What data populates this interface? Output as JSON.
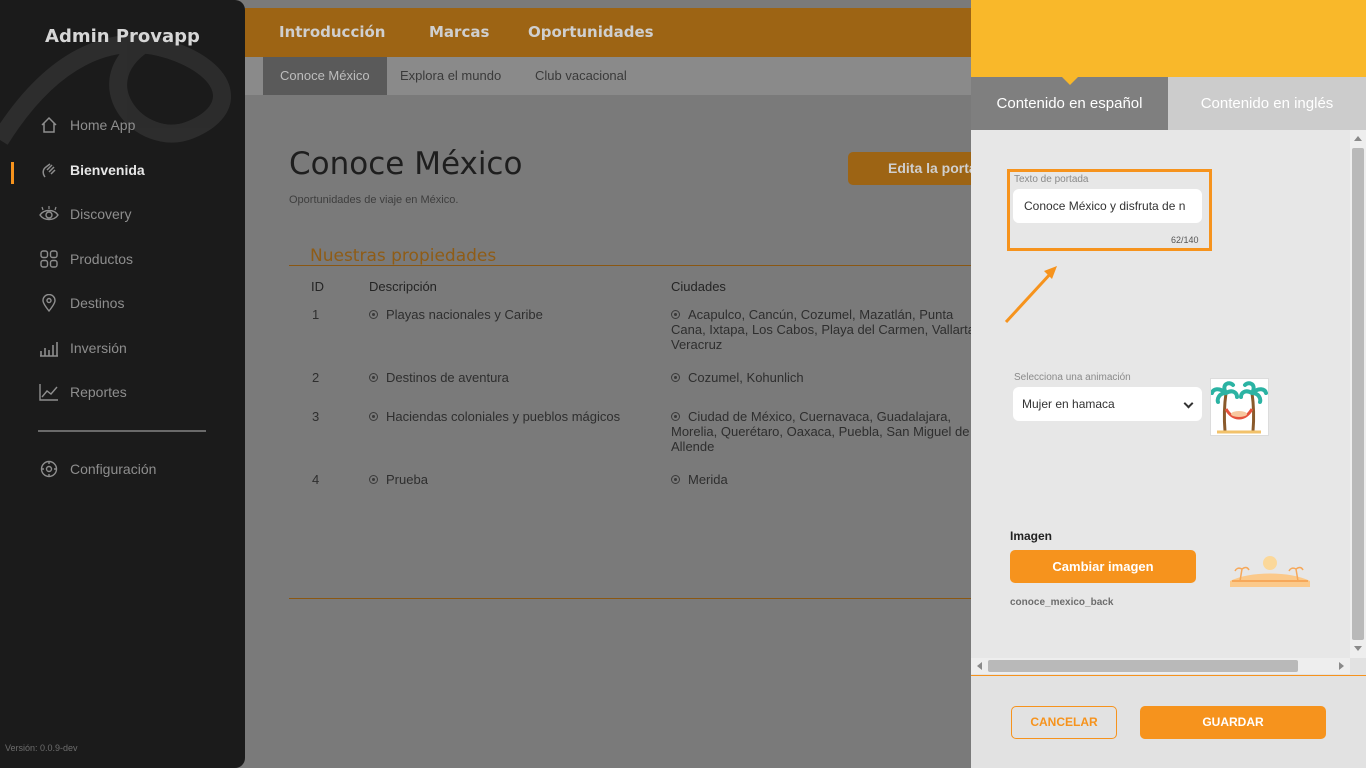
{
  "sidebar": {
    "brand": "Admin Provapp",
    "items": [
      {
        "label": "Home App",
        "icon": "home-icon"
      },
      {
        "label": "Bienvenida",
        "icon": "wave-hand-icon",
        "active": true
      },
      {
        "label": "Discovery",
        "icon": "eye-icon"
      },
      {
        "label": "Productos",
        "icon": "grid-icon"
      },
      {
        "label": "Destinos",
        "icon": "map-pin-icon"
      },
      {
        "label": "Inversión",
        "icon": "bar-chart-icon"
      },
      {
        "label": "Reportes",
        "icon": "line-chart-icon"
      }
    ],
    "settings": {
      "label": "Configuración",
      "icon": "gear-icon"
    },
    "version": "Versión: 0.0.9-dev"
  },
  "topnav": {
    "tabs": [
      "Introducción",
      "Marcas",
      "Oportunidades"
    ],
    "active": "Oportunidades"
  },
  "subnav": {
    "tabs": [
      "Conoce México",
      "Explora el mundo",
      "Club vacacional"
    ],
    "active": "Conoce México"
  },
  "main": {
    "title": "Conoce México",
    "subtitle": "Oportunidades de viaje en México.",
    "edit_button": "Edita la porta",
    "section_title": "Nuestras propiedades",
    "table": {
      "headers": [
        "ID",
        "Descripción",
        "Ciudades"
      ],
      "rows": [
        {
          "id": "1",
          "desc": "Playas nacionales y Caribe",
          "cities": [
            "Acapulco, Cancún, Cozumel, Mazatlán, Punta",
            "Cana, Ixtapa, Los Cabos, Playa del Carmen, Vallarta,",
            "Veracruz"
          ]
        },
        {
          "id": "2",
          "desc": "Destinos de aventura",
          "cities": [
            "Cozumel, Kohunlich"
          ]
        },
        {
          "id": "3",
          "desc": "Haciendas coloniales y pueblos mágicos",
          "cities": [
            "Ciudad de México, Cuernavaca, Guadalajara,",
            "Morelia, Querétaro, Oaxaca, Puebla, San Miguel de",
            "Allende"
          ]
        },
        {
          "id": "4",
          "desc": "Prueba",
          "cities": [
            "Merida"
          ]
        }
      ]
    }
  },
  "panel": {
    "tabs": {
      "spanish": "Contenido en español",
      "english": "Contenido en inglés"
    },
    "cover_text": {
      "label": "Texto de portada",
      "value": "Conoce México y disfruta de n",
      "counter": "62/140"
    },
    "animation": {
      "label": "Selecciona una animación",
      "selected": "Mujer en hamaca"
    },
    "image": {
      "label": "Imagen",
      "change_button": "Cambiar imagen",
      "filename": "conoce_mexico_back"
    },
    "cancel_button": "CANCELAR",
    "save_button": "GUARDAR"
  },
  "colors": {
    "accent": "#f6931d",
    "header_yellow": "#f9b82a",
    "sidebar_bg": "#1b1b1b",
    "overlay": "#7a7a7a"
  }
}
